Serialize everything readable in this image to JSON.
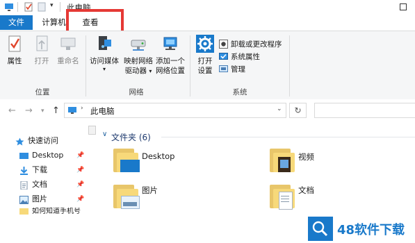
{
  "window": {
    "title": "此电脑"
  },
  "tabs": [
    {
      "label": "文件"
    },
    {
      "label": "计算机"
    },
    {
      "label": "查看"
    }
  ],
  "ribbon": {
    "location_group": {
      "label": "位置",
      "buttons": [
        {
          "label": "属性"
        },
        {
          "label": "打开"
        },
        {
          "label": "重命名"
        }
      ]
    },
    "network_group": {
      "label": "网络",
      "buttons": [
        {
          "line1": "访问媒体",
          "line2": ""
        },
        {
          "line1": "映射网络",
          "line2": "驱动器"
        },
        {
          "line1": "添加一个",
          "line2": "网络位置"
        }
      ]
    },
    "system_group": {
      "label": "系统",
      "open_settings": {
        "line1": "打开",
        "line2": "设置"
      },
      "small_buttons": [
        {
          "label": "卸载或更改程序"
        },
        {
          "label": "系统属性"
        },
        {
          "label": "管理"
        }
      ]
    }
  },
  "address": {
    "path": "此电脑",
    "up_arrow": "↑",
    "refresh": "↻"
  },
  "nav_pane": {
    "items": [
      {
        "label": "快速访问"
      },
      {
        "label": "Desktop"
      },
      {
        "label": "下载"
      },
      {
        "label": "文档"
      },
      {
        "label": "图片"
      },
      {
        "label": "如何知道手机号"
      }
    ]
  },
  "content": {
    "section_header": "文件夹 (6)",
    "folders": [
      {
        "label": "Desktop"
      },
      {
        "label": "视频"
      },
      {
        "label": "图片"
      },
      {
        "label": "文档"
      }
    ]
  },
  "watermark": {
    "text": "48软件下载"
  },
  "colors": {
    "accent": "#1979ca",
    "highlight": "#e53935",
    "folder": "#f7d97a"
  }
}
